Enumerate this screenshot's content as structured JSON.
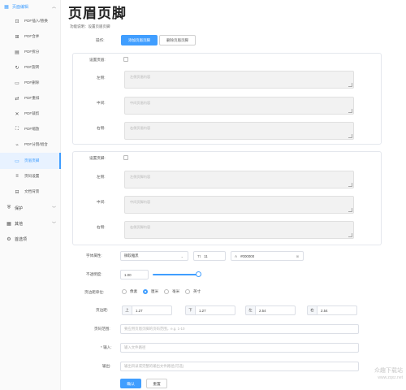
{
  "sidebar": {
    "top_group": {
      "label": "页面编辑",
      "icon": "grid-icon"
    },
    "items": [
      {
        "label": "PDF插入/替换",
        "icon": "insert-icon"
      },
      {
        "label": "PDF合并",
        "icon": "merge-icon"
      },
      {
        "label": "PDF拆分",
        "icon": "split-icon"
      },
      {
        "label": "PDF旋转",
        "icon": "rotate-icon"
      },
      {
        "label": "PDF删除",
        "icon": "delete-icon"
      },
      {
        "label": "PDF重排",
        "icon": "reorder-icon"
      },
      {
        "label": "PDF裁剪",
        "icon": "crop-icon"
      },
      {
        "label": "PDF缩放",
        "icon": "scale-icon"
      },
      {
        "label": "PDF分割/组合",
        "icon": "split-combine-icon"
      },
      {
        "label": "页眉页脚",
        "icon": "header-footer-icon",
        "active": true
      },
      {
        "label": "页码设置",
        "icon": "page-number-icon"
      },
      {
        "label": "文档背景",
        "icon": "background-icon"
      }
    ],
    "groups": [
      {
        "label": "保护",
        "icon": "shield-icon"
      },
      {
        "label": "其他",
        "icon": "other-icon"
      }
    ],
    "settings": {
      "label": "首选项",
      "icon": "gear-icon"
    }
  },
  "page": {
    "title": "页眉页脚",
    "description": "功能说明：设置页眉页脚"
  },
  "operation": {
    "label": "操作:",
    "tabs": [
      "添加页眉页脚",
      "删除页眉页脚"
    ],
    "active_tab": 0
  },
  "header_section": {
    "toggle_label": "设置页眉:",
    "rows": [
      {
        "label": "左侧:",
        "placeholder": "左侧页眉内容"
      },
      {
        "label": "中间:",
        "placeholder": "中间页眉内容"
      },
      {
        "label": "右侧:",
        "placeholder": "右侧页眉内容"
      }
    ]
  },
  "footer_section": {
    "toggle_label": "设置页脚:",
    "rows": [
      {
        "label": "左侧:",
        "placeholder": "左侧页脚内容"
      },
      {
        "label": "中间:",
        "placeholder": "中间页脚内容"
      },
      {
        "label": "右侧:",
        "placeholder": "右侧页脚内容"
      }
    ]
  },
  "font": {
    "label": "字体属性:",
    "family": "微软雅黑",
    "size_prefix": "Tt",
    "size": "11",
    "color_prefix": "A",
    "color_value": "#000000"
  },
  "opacity": {
    "label": "不透明度:",
    "value": "1.00",
    "level": 1.0
  },
  "unit": {
    "label": "页边距单位:",
    "options": [
      "像素",
      "厘米",
      "毫米",
      "英寸"
    ],
    "selected": 1
  },
  "margins": {
    "label": "页边距:",
    "items": [
      {
        "side": "上",
        "value": "1.27"
      },
      {
        "side": "下",
        "value": "1.27"
      },
      {
        "side": "左",
        "value": "2.54"
      },
      {
        "side": "右",
        "value": "2.54"
      }
    ]
  },
  "page_range": {
    "label": "页码范围:",
    "placeholder": "要应用页眉页脚的页码范围，e.g. 1-10"
  },
  "input": {
    "label": "* 输入:",
    "placeholder": "输入文件路径"
  },
  "output": {
    "label": "输出:",
    "placeholder": "输出目录或完整的输出文件路径(可选)"
  },
  "buttons": {
    "confirm": "确认",
    "reset": "重置"
  },
  "colors": {
    "accent": "#409eff",
    "active_bg": "#e8f2ff",
    "field_bg": "#f2f2f2",
    "border": "#dcdfe6"
  },
  "watermark": {
    "line1": "众趣下载站",
    "line2": "www.zqxz.net"
  }
}
